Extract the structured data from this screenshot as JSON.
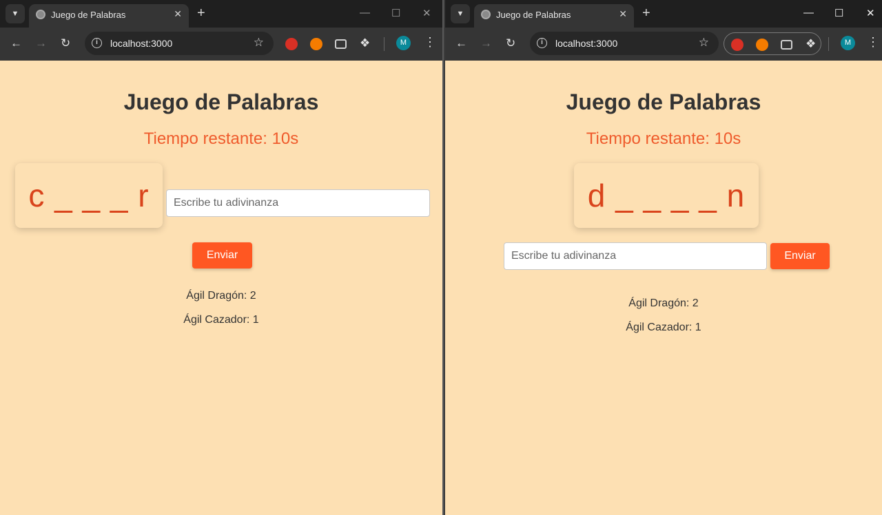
{
  "tab_title": "Juego de Palabras",
  "url": "localhost:3000",
  "profile_initial": "M",
  "page": {
    "title": "Juego de Palabras",
    "timer": "Tiempo restante: 10s",
    "input_placeholder": "Escribe tu adivinanza",
    "send_label": "Enviar"
  },
  "windows": [
    {
      "word": "c _ _ _ r",
      "scores": [
        "Ágil Dragón: 2",
        "Ágil Cazador: 1"
      ]
    },
    {
      "word": "d _ _ _ _ n",
      "scores": [
        "Ágil Dragón: 2",
        "Ágil Cazador: 1"
      ]
    }
  ],
  "icons": {
    "tab_search": "chevron-down-icon",
    "favicon": "globe-icon",
    "tab_close": "close-icon",
    "new_tab": "plus-icon",
    "back": "arrow-left-icon",
    "forward": "arrow-right-icon",
    "reload": "reload-icon",
    "site_info": "info-icon",
    "bookmark": "star-icon",
    "extensions": "puzzle-icon",
    "menu": "kebab-icon"
  },
  "colors": {
    "page_background": "#fde0b3",
    "accent": "#ff5722",
    "timer": "#ef5b2c",
    "word": "#d9441c"
  }
}
